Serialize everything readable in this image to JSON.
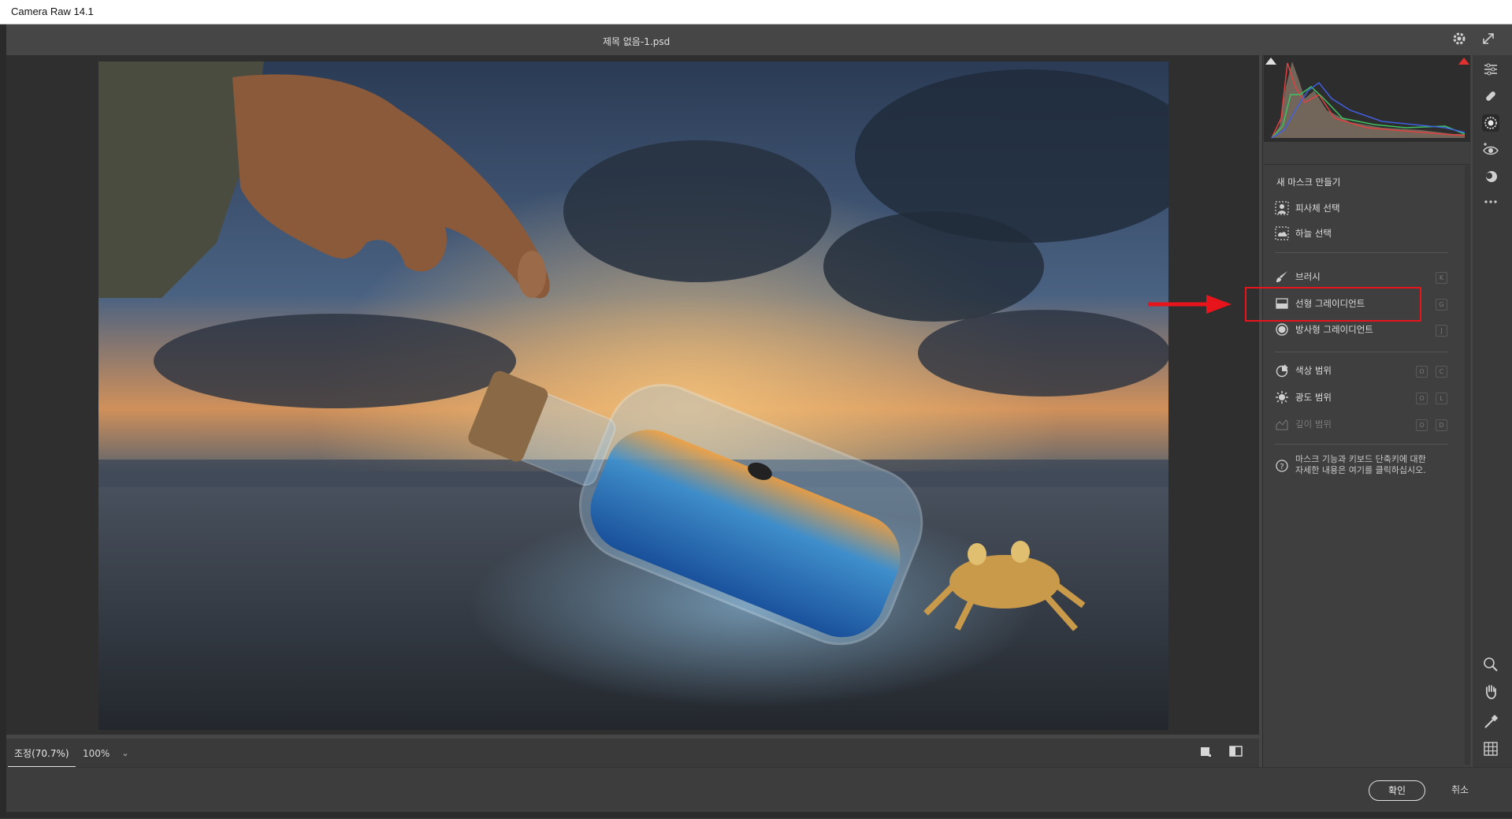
{
  "window": {
    "title": "Camera Raw 14.1"
  },
  "header": {
    "filename": "제목 없음-1.psd"
  },
  "zoom": {
    "fit_label": "조정(70.7%)",
    "zoom_label": "100%",
    "dropdown": "⌄"
  },
  "mask_panel": {
    "title": "새 마스크 만들기",
    "items": [
      {
        "label": "피사체 선택",
        "icon": "subject-icon"
      },
      {
        "label": "하늘 선택",
        "icon": "sky-icon"
      },
      {
        "label": "브러시",
        "icon": "brush-icon",
        "shortcut": "K"
      },
      {
        "label": "선형 그레이디언트",
        "icon": "linear-gradient-icon",
        "shortcut": "G"
      },
      {
        "label": "방사형 그레이디언트",
        "icon": "radial-gradient-icon",
        "shortcut": "J"
      },
      {
        "label": "색상 범위",
        "icon": "color-range-icon",
        "shortcut1": "O",
        "shortcut2": "C"
      },
      {
        "label": "광도 범위",
        "icon": "luminance-range-icon",
        "shortcut1": "O",
        "shortcut2": "L"
      },
      {
        "label": "깊이 범위",
        "icon": "depth-range-icon",
        "shortcut1": "O",
        "shortcut2": "D"
      }
    ],
    "help_line1": "마스크 기능과 키보드 단축키에 대한",
    "help_line2": "자세한 내용은 여기를 클릭하십시오."
  },
  "buttons": {
    "ok": "확인",
    "cancel": "취소"
  },
  "colors": {
    "accent_red": "#e8141c",
    "panel_bg": "#3f3f3f"
  }
}
